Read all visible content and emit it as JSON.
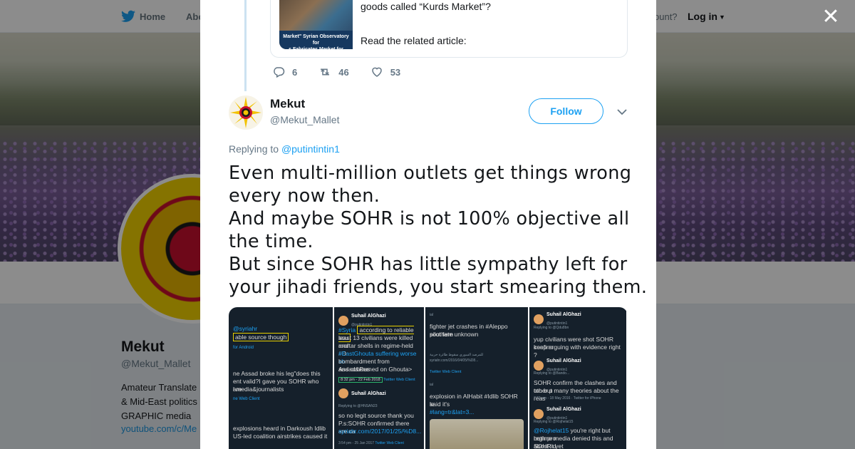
{
  "nav": {
    "home": "Home",
    "about": "Abo",
    "account_prompt": "ccount?",
    "login": "Log in"
  },
  "profile": {
    "name": "Mekut",
    "handle": "@Mekut_Mallet",
    "bio": "Amateur Translate\n& Mid-East politics\nGRAPHIC media",
    "link": "youtube.com/c/Me"
  },
  "quoted": {
    "text_partial": "What's the purpose of fabricating a market for looted goods called “Kurds Market”?",
    "related": "Read the related article:",
    "thumb_caption": "Market\" Syrian Observatory for\ns Fabricates Market for Looted"
  },
  "prev_actions": {
    "replies": "6",
    "retweets": "46",
    "likes": "53"
  },
  "tweet": {
    "name": "Mekut",
    "handle": "@Mekut_Mallet",
    "follow_label": "Follow",
    "replying_prefix": "Replying to",
    "replying_to": "@putintintin1",
    "lines": [
      "Even multi-million outlets get things wrong",
      "every now then.",
      "And maybe SOHR is not 100% objective all",
      "the time.",
      "But since SOHR has little sympathy left for",
      "your jihadi friends, you start smearing them."
    ]
  },
  "media": {
    "shot1": {
      "l1": "@syriahr",
      "l2": "able source though",
      "l3": "for Android",
      "l4": "ne Assad broke his leg\"does this",
      "l5": "ent valid?I gave you SOHR who are",
      "l6": "l media&journalists",
      "l7": "ne Web Client",
      "l8": "explosions heard in Darkoush Idlib",
      "l9": "US-led coalition airstrikes caused it"
    },
    "shot2": {
      "name": "Suhail AlGhazi",
      "handle": "@putintintin1",
      "l1a": "#Syria",
      "l1b": "according to reliable sou",
      "l2": "least 13 civilians were killed and",
      "l3": "mortar shells in regime-held #D",
      "l4": "#EastGhouta suffering worse sh",
      "l5": "bombardment from Assad&Rus",
      "l6": "and concerned on Ghouta>",
      "l7": "8:32 pm - 22 Feb 2018",
      "l7b": "Twitter Web Client",
      "name2": "Suhail AlGhazi",
      "l8": "Replying to @HNSAN23",
      "l9": "so no legit source thank you",
      "l10": "P.s:SOHR confirmed there are ca",
      "l11": "syriahr.com/2017/01/25/%D8...",
      "l12": "3:54 pm - 25 Jan 2017",
      "l12b": "Twitter Web Client"
    },
    "shot3": {
      "l0": "ial",
      "l1": "fighter jet crashes in #Aleppo southern",
      "l2": "pilot fate unknown",
      "l3": "للمرصد السوري سقوط طائرة حربية",
      "l4": "syriahr.com/2016/04/05/%D8...",
      "l5": "Twitter Web Client",
      "l6": "ial",
      "l7": "explosion in AlHabit #Idlib SOHR said it's",
      "l8": "le",
      "l9": "#lang=tr&lat=3..."
    },
    "shot4": {
      "name": "Suhail AlGhazi",
      "handle": "@putintintin1",
      "l1": "Replying to @Qdu8bn",
      "l2": "yup civilians were shot SOHR confirm",
      "l3": "keep arguing with evidence right ?",
      "name2": "Suhail AlGhazi",
      "handle2": "@putintintin1",
      "l4": "Replying to @Bando...",
      "l5": "SOHR confirm the clashes and other p",
      "l6": "too but many theories about the reas",
      "l7": "7:21 pm - 18 May 2016 · Twitter for iPhone",
      "name3": "Suhail AlGhazi",
      "handle3": "@putintintin1",
      "l8": "Replying to @Rojhelat15",
      "l9a": "@Rojhelat15",
      "l9b": " you're right but both pro",
      "l10": "regime media denied this and SOHR d",
      "l11": "about it yet"
    }
  },
  "colors": {
    "accent": "#1da1f2",
    "thread": "#cce2f1",
    "text": "#14171a",
    "muted": "#657786"
  },
  "icons": {
    "close": "close-icon",
    "reply": "reply-icon",
    "retweet": "retweet-icon",
    "like": "heart-icon",
    "caret": "chevron-down-icon",
    "bird": "twitter-bird-icon"
  }
}
